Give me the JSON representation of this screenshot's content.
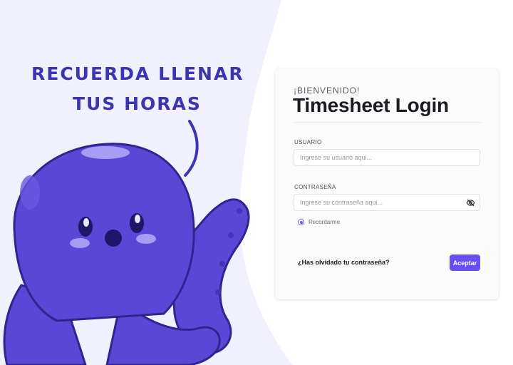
{
  "illustration": {
    "line1": "RECUERDA LLENAR",
    "line2": "TUS HORAS",
    "mascot": "octopus-mascot"
  },
  "login": {
    "welcome": "¡BIENVENIDO!",
    "title": "Timesheet Login",
    "username_label": "USUARIO",
    "username_placeholder": "Ingrese su usuario aqui...",
    "username_value": "",
    "password_label": "CONTRASEÑA",
    "password_placeholder": "Ingrese su contraseña aqui...",
    "password_value": "",
    "remember_label": "Recordarme",
    "remember_checked": true,
    "forgot_label": "¿Has olvidado tu contraseña?",
    "submit_label": "Aceptar"
  },
  "colors": {
    "accent": "#6a4ef5",
    "lavender_bg": "#f1f0ff",
    "mascot_body": "#5a47d6"
  },
  "icons": {
    "password_toggle": "eye-slash-icon"
  }
}
